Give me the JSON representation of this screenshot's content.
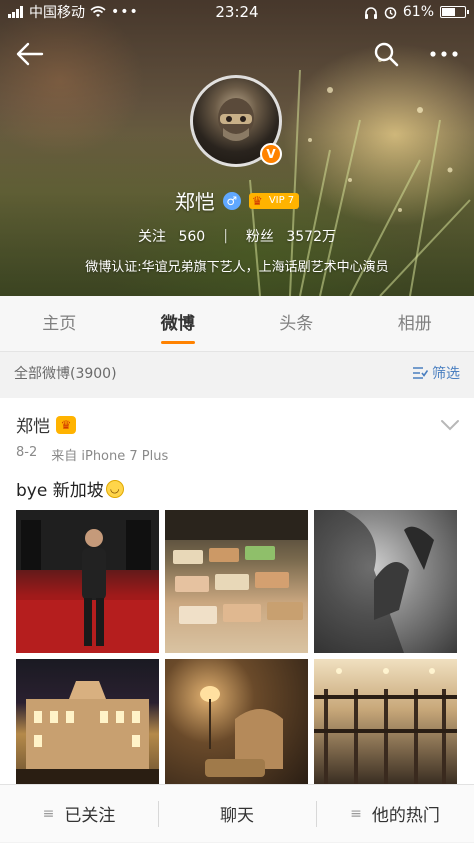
{
  "status_bar": {
    "carrier": "中国移动",
    "time": "23:24",
    "battery": "61%",
    "battery_level": 0.61
  },
  "header": {
    "back_icon": "arrow-left-icon",
    "search_icon": "search-icon",
    "more_icon": "more-horizontal-icon"
  },
  "profile": {
    "name": "郑恺",
    "verified_badge": "V",
    "vip_label": "VIP 7",
    "following_label": "关注",
    "following_count": "560",
    "followers_label": "粉丝",
    "followers_count": "3572万",
    "verification": "微博认证:华谊兄弟旗下艺人，上海话剧艺术中心演员"
  },
  "tabs": [
    {
      "label": "主页",
      "active": false
    },
    {
      "label": "微博",
      "active": true
    },
    {
      "label": "头条",
      "active": false
    },
    {
      "label": "相册",
      "active": false
    }
  ],
  "filter": {
    "all_posts": "全部微博(3900)",
    "filter_label": "筛选"
  },
  "post": {
    "author": "郑恺",
    "date": "8-2",
    "source": "来自 iPhone 7 Plus",
    "text": "bye 新加坡",
    "photos": [
      {
        "name": "photo-wetsuit-man"
      },
      {
        "name": "photo-food-display"
      },
      {
        "name": "photo-hand-silhouette"
      },
      {
        "name": "photo-hotel-facade"
      },
      {
        "name": "photo-armchair-lamp"
      },
      {
        "name": "photo-hotel-interior"
      }
    ]
  },
  "bottom_bar": {
    "followed": "已关注",
    "chat": "聊天",
    "hot": "他的热门"
  },
  "colors": {
    "accent": "#ff8200",
    "link": "#4a7fc0",
    "vip": "#ffb300"
  }
}
